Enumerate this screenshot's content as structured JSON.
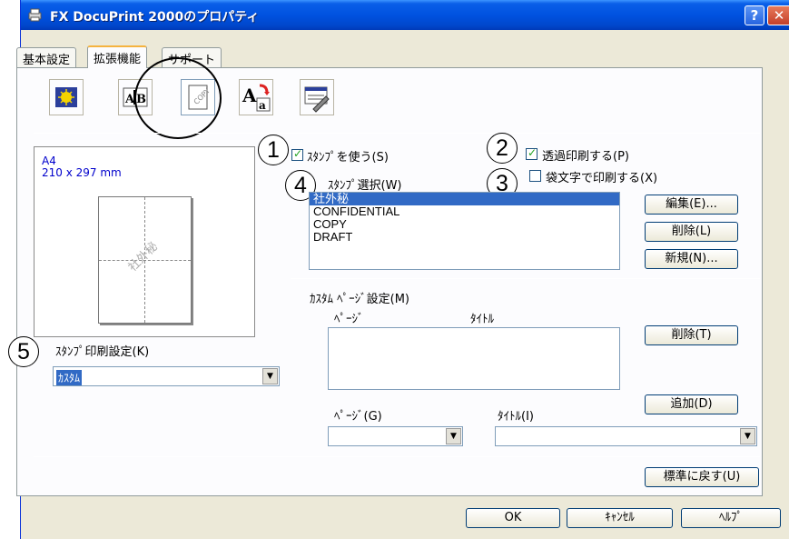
{
  "window": {
    "title": "FX DocuPrint 2000のプロパティ",
    "help_glyph": "?",
    "close_glyph": "✕"
  },
  "tabs": [
    "基本設定",
    "拡張機能",
    "サポート"
  ],
  "toolbar_icons": [
    "watermark-icon",
    "text-layout-icon",
    "stamp-copy-icon",
    "font-icon",
    "device-settings-icon"
  ],
  "preview": {
    "paper": "A4",
    "dimensions": "210 x 297 mm",
    "watermark": "社外秘"
  },
  "callouts": [
    "1",
    "2",
    "3",
    "4",
    "5"
  ],
  "stamp": {
    "use_label": "ｽﾀﾝﾌﾟを使う(S)",
    "use_checked": true,
    "transparent_label": "透過印刷する(P)",
    "transparent_checked": true,
    "outline_label": "袋文字で印刷する(X)",
    "outline_checked": false,
    "select_label": "ｽﾀﾝﾌﾟ選択(W)",
    "items": [
      "社外秘",
      "CONFIDENTIAL",
      "COPY",
      "DRAFT"
    ],
    "selected_index": 0,
    "edit_button": "編集(E)...",
    "delete_button": "削除(L)",
    "new_button": "新規(N)..."
  },
  "custom_pages": {
    "title": "ｶｽﾀﾑ ﾍﾟｰｼﾞ設定(M)",
    "col_page": "ﾍﾟｰｼﾞ",
    "col_title": "ﾀｲﾄﾙ",
    "delete_button": "削除(T)",
    "add_button": "追加(D)",
    "page_label": "ﾍﾟｰｼﾞ(G)",
    "title_label": "ﾀｲﾄﾙ(I)",
    "page_value": "",
    "title_value": ""
  },
  "print_setting": {
    "label": "ｽﾀﾝﾌﾟ印刷設定(K)",
    "value": "ｶｽﾀﾑ"
  },
  "buttons": {
    "reset": "標準に戻す(U)",
    "ok": "OK",
    "cancel": "ｷｬﾝｾﾙ",
    "help": "ﾍﾙﾌﾟ"
  },
  "colors": {
    "titlebar": "#0052e0",
    "dialog": "#ece9d8",
    "selection": "#316ac5"
  }
}
